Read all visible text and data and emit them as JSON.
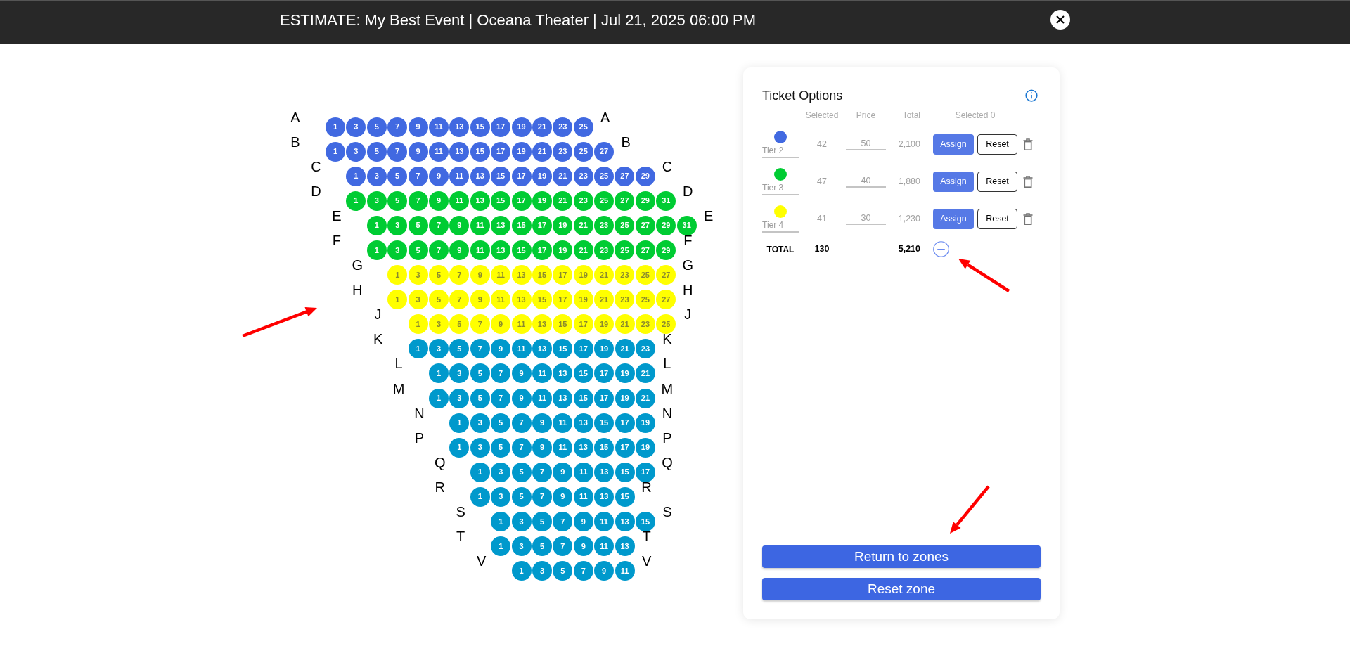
{
  "header": {
    "title": "ESTIMATE: My Best Event | Oceana Theater | Jul 21, 2025 06:00 PM"
  },
  "seat_map": {
    "rows": [
      {
        "label_left": "A",
        "label_right": "A",
        "color": "#4169e1",
        "seats": [
          "1",
          "3",
          "5",
          "7",
          "9",
          "11",
          "13",
          "15",
          "17",
          "19",
          "21",
          "23",
          "25"
        ]
      },
      {
        "label_left": "B",
        "label_right": "B",
        "color": "#4169e1",
        "seats": [
          "1",
          "3",
          "5",
          "7",
          "9",
          "11",
          "13",
          "15",
          "17",
          "19",
          "21",
          "23",
          "25",
          "27"
        ]
      },
      {
        "label_left": "C",
        "label_right": "C",
        "color": "#4169e1",
        "seats": [
          "1",
          "3",
          "5",
          "7",
          "9",
          "11",
          "13",
          "15",
          "17",
          "19",
          "21",
          "23",
          "25",
          "27",
          "29"
        ]
      },
      {
        "label_left": "D",
        "label_right": "D",
        "color": "#00cc33",
        "seats": [
          "1",
          "3",
          "5",
          "7",
          "9",
          "11",
          "13",
          "15",
          "17",
          "19",
          "21",
          "23",
          "25",
          "27",
          "29",
          "31"
        ]
      },
      {
        "label_left": "E",
        "label_right": "E",
        "color": "#00cc33",
        "seats": [
          "1",
          "3",
          "5",
          "7",
          "9",
          "11",
          "13",
          "15",
          "17",
          "19",
          "21",
          "23",
          "25",
          "27",
          "29",
          "31"
        ]
      },
      {
        "label_left": "F",
        "label_right": "F",
        "color": "#00cc33",
        "seats": [
          "1",
          "3",
          "5",
          "7",
          "9",
          "11",
          "13",
          "15",
          "17",
          "19",
          "21",
          "23",
          "25",
          "27",
          "29"
        ]
      },
      {
        "label_left": "G",
        "label_right": "G",
        "color": "#ffff00",
        "seats": [
          "1",
          "3",
          "5",
          "7",
          "9",
          "11",
          "13",
          "15",
          "17",
          "19",
          "21",
          "23",
          "25",
          "27"
        ]
      },
      {
        "label_left": "H",
        "label_right": "H",
        "color": "#ffff00",
        "seats": [
          "1",
          "3",
          "5",
          "7",
          "9",
          "11",
          "13",
          "15",
          "17",
          "19",
          "21",
          "23",
          "25",
          "27"
        ]
      },
      {
        "label_left": "J",
        "label_right": "J",
        "color": "#ffff00",
        "seats": [
          "1",
          "3",
          "5",
          "7",
          "9",
          "11",
          "13",
          "15",
          "17",
          "19",
          "21",
          "23",
          "25"
        ]
      },
      {
        "label_left": "K",
        "label_right": "K",
        "color": "#0099cc",
        "seats": [
          "1",
          "3",
          "5",
          "7",
          "9",
          "11",
          "13",
          "15",
          "17",
          "19",
          "21",
          "23"
        ]
      },
      {
        "label_left": "L",
        "label_right": "L",
        "color": "#0099cc",
        "seats": [
          "1",
          "3",
          "5",
          "7",
          "9",
          "11",
          "13",
          "15",
          "17",
          "19",
          "21"
        ]
      },
      {
        "label_left": "M",
        "label_right": "M",
        "color": "#0099cc",
        "seats": [
          "1",
          "3",
          "5",
          "7",
          "9",
          "11",
          "13",
          "15",
          "17",
          "19",
          "21"
        ]
      },
      {
        "label_left": "N",
        "label_right": "N",
        "color": "#0099cc",
        "seats": [
          "1",
          "3",
          "5",
          "7",
          "9",
          "11",
          "13",
          "15",
          "17",
          "19"
        ]
      },
      {
        "label_left": "P",
        "label_right": "P",
        "color": "#0099cc",
        "seats": [
          "1",
          "3",
          "5",
          "7",
          "9",
          "11",
          "13",
          "15",
          "17",
          "19"
        ]
      },
      {
        "label_left": "Q",
        "label_right": "Q",
        "color": "#0099cc",
        "seats": [
          "1",
          "3",
          "5",
          "7",
          "9",
          "11",
          "13",
          "15",
          "17"
        ]
      },
      {
        "label_left": "R",
        "label_right": "R",
        "color": "#0099cc",
        "seats": [
          "1",
          "3",
          "5",
          "7",
          "9",
          "11",
          "13",
          "15"
        ]
      },
      {
        "label_left": "S",
        "label_right": "S",
        "color": "#0099cc",
        "seats": [
          "1",
          "3",
          "5",
          "7",
          "9",
          "11",
          "13",
          "15"
        ]
      },
      {
        "label_left": "T",
        "label_right": "T",
        "color": "#0099cc",
        "seats": [
          "1",
          "3",
          "5",
          "7",
          "9",
          "11",
          "13"
        ]
      },
      {
        "label_left": "V",
        "label_right": "V",
        "color": "#0099cc",
        "seats": [
          "1",
          "3",
          "5",
          "7",
          "9",
          "11"
        ]
      }
    ]
  },
  "ticket_options": {
    "title": "Ticket Options",
    "columns": [
      "Selected",
      "Price",
      "Total",
      "Selected 0"
    ],
    "tiers": [
      {
        "color": "#4169e1",
        "name": "Tier 2",
        "selected_count": "42",
        "price": "50",
        "total": "2,100",
        "assign_label": "Assign",
        "reset_label": "Reset"
      },
      {
        "color": "#00cc33",
        "name": "Tier 3",
        "selected_count": "47",
        "price": "40",
        "total": "1,880",
        "assign_label": "Assign",
        "reset_label": "Reset"
      },
      {
        "color": "#ffff00",
        "name": "Tier 4",
        "selected_count": "41",
        "price": "30",
        "total": "1,230",
        "assign_label": "Assign",
        "reset_label": "Reset"
      }
    ],
    "total_row": {
      "label": "TOTAL",
      "selected_count": "130",
      "total": "5,210"
    }
  },
  "footer_buttons": [
    "Return to zones",
    "Reset zone"
  ]
}
